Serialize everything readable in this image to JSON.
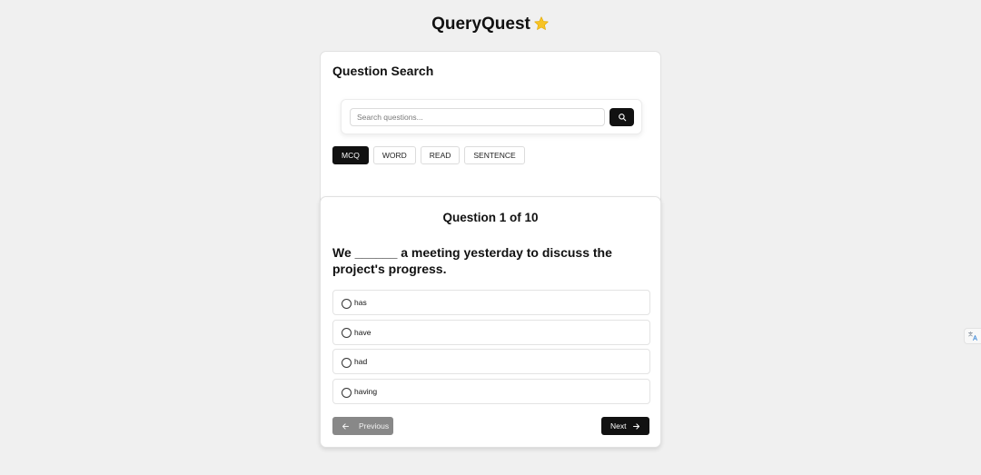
{
  "app": {
    "title": "QueryQuest",
    "title_icon": "star-icon"
  },
  "search": {
    "heading": "Question Search",
    "placeholder": "Search questions...",
    "value": "",
    "button_icon": "search-icon"
  },
  "filters": [
    {
      "label": "MCQ",
      "active": true
    },
    {
      "label": "WORD",
      "active": false
    },
    {
      "label": "READ",
      "active": false
    },
    {
      "label": "SENTENCE",
      "active": false
    }
  ],
  "question": {
    "counter": "Question 1 of 10",
    "text": "We ______ a meeting yesterday to discuss the project's progress.",
    "options": [
      {
        "label": "has",
        "selected": false
      },
      {
        "label": "have",
        "selected": false
      },
      {
        "label": "had",
        "selected": false
      },
      {
        "label": "having",
        "selected": false
      }
    ]
  },
  "navigation": {
    "previous_label": "Previous",
    "next_label": "Next"
  },
  "colors": {
    "accent": "#111111",
    "star": "#f7c325",
    "disabled": "#888888",
    "background": "#f0f0f0"
  }
}
